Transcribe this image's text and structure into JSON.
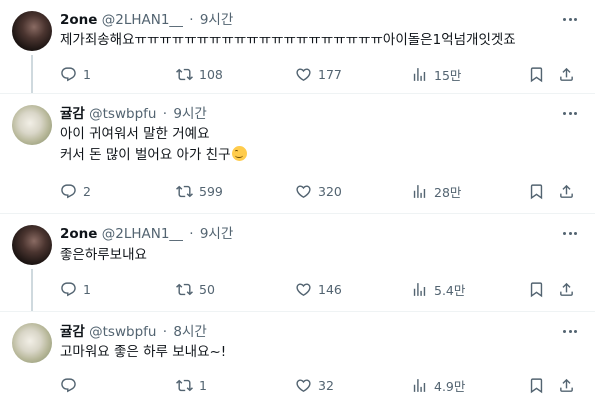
{
  "tweets": [
    {
      "name": "2one",
      "handle": "@2LHAN1__",
      "dot": "·",
      "time": "9시간",
      "lines": [
        "제가죄송해요ㅠㅠㅠㅠㅠㅠㅠㅠㅠㅠㅠㅠㅠㅠㅠㅠㅠㅠㅠㅠ아이돌은1억넘개잇겟죠"
      ],
      "replies": "1",
      "retweets": "108",
      "likes": "177",
      "views": "15만"
    },
    {
      "name": "귤감",
      "handle": "@tswbpfu",
      "dot": "·",
      "time": "9시간",
      "lines": [
        "아이 귀여워서 말한 거예요",
        "커서 돈 많이 벌어요 아가 친구"
      ],
      "emoji": "smiling-face-emoji",
      "replies": "2",
      "retweets": "599",
      "likes": "320",
      "views": "28만"
    },
    {
      "name": "2one",
      "handle": "@2LHAN1__",
      "dot": "·",
      "time": "9시간",
      "lines": [
        "좋은하루보내요"
      ],
      "replies": "1",
      "retweets": "50",
      "likes": "146",
      "views": "5.4만"
    },
    {
      "name": "귤감",
      "handle": "@tswbpfu",
      "dot": "·",
      "time": "8시간",
      "lines": [
        "고마워요 좋은 하루 보내요~!"
      ],
      "replies": "",
      "retweets": "1",
      "likes": "32",
      "views": "4.9만"
    }
  ],
  "icons": {
    "reply": "reply-icon",
    "retweet": "retweet-icon",
    "like": "heart-icon",
    "views": "views-icon",
    "bookmark": "bookmark-icon",
    "share": "share-icon",
    "more": "more-icon"
  },
  "colors": {
    "text": "#0f1419",
    "muted": "#536471",
    "thread_line": "#cfd9de",
    "separator": "#eff3f4"
  }
}
